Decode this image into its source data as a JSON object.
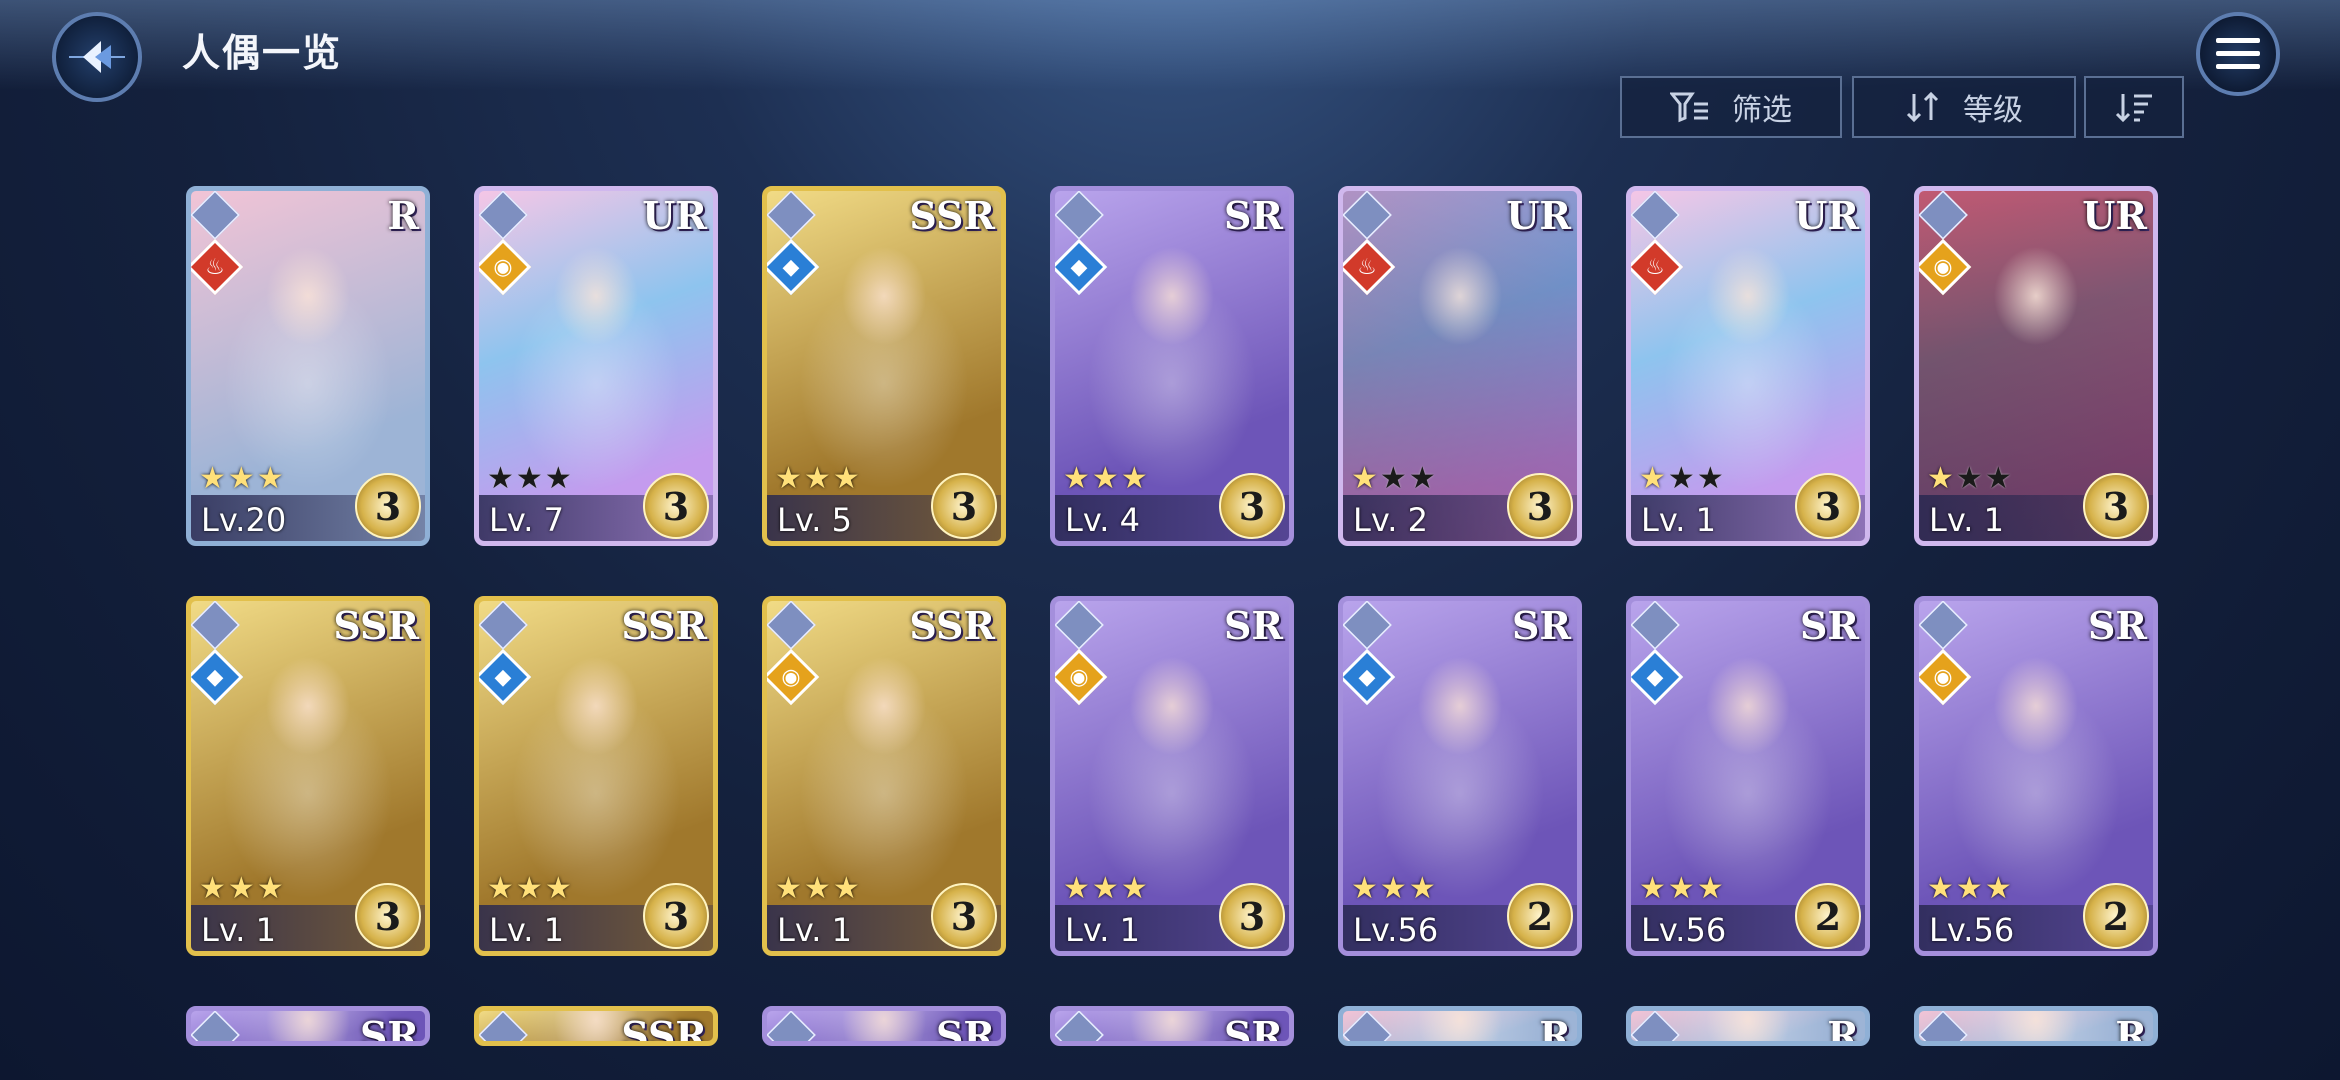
{
  "header": {
    "title": "人偶一览"
  },
  "toolbar": {
    "filter_label": "筛选",
    "sort_label": "等级"
  },
  "cards": [
    {
      "rarity": "R",
      "element": "fire",
      "stars": 3,
      "max_stars": 3,
      "level": "Lv.20",
      "count": "3"
    },
    {
      "rarity": "UR",
      "element": "light",
      "stars": 0,
      "max_stars": 3,
      "level": "Lv. 7",
      "count": "3"
    },
    {
      "rarity": "SSR",
      "element": "water",
      "stars": 3,
      "max_stars": 3,
      "level": "Lv. 5",
      "count": "3"
    },
    {
      "rarity": "SR",
      "element": "water",
      "stars": 3,
      "max_stars": 3,
      "level": "Lv. 4",
      "count": "3"
    },
    {
      "rarity": "UR",
      "element": "fire",
      "stars": 1,
      "max_stars": 3,
      "level": "Lv. 2",
      "count": "3"
    },
    {
      "rarity": "UR",
      "element": "fire",
      "stars": 1,
      "max_stars": 3,
      "level": "Lv. 1",
      "count": "3"
    },
    {
      "rarity": "UR",
      "element": "light",
      "stars": 1,
      "max_stars": 3,
      "level": "Lv. 1",
      "count": "3"
    },
    {
      "rarity": "SSR",
      "element": "water",
      "stars": 3,
      "max_stars": 3,
      "level": "Lv. 1",
      "count": "3"
    },
    {
      "rarity": "SSR",
      "element": "water",
      "stars": 3,
      "max_stars": 3,
      "level": "Lv. 1",
      "count": "3"
    },
    {
      "rarity": "SSR",
      "element": "light",
      "stars": 3,
      "max_stars": 3,
      "level": "Lv. 1",
      "count": "3"
    },
    {
      "rarity": "SR",
      "element": "light",
      "stars": 3,
      "max_stars": 3,
      "level": "Lv. 1",
      "count": "3"
    },
    {
      "rarity": "SR",
      "element": "water",
      "stars": 3,
      "max_stars": 3,
      "level": "Lv.56",
      "count": "2"
    },
    {
      "rarity": "SR",
      "element": "water",
      "stars": 3,
      "max_stars": 3,
      "level": "Lv.56",
      "count": "2"
    },
    {
      "rarity": "SR",
      "element": "light",
      "stars": 3,
      "max_stars": 3,
      "level": "Lv.56",
      "count": "2"
    },
    {
      "rarity": "SR",
      "element": "",
      "stars": 0,
      "max_stars": 0,
      "level": "",
      "count": ""
    },
    {
      "rarity": "SSR",
      "element": "",
      "stars": 0,
      "max_stars": 0,
      "level": "",
      "count": ""
    },
    {
      "rarity": "SR",
      "element": "",
      "stars": 0,
      "max_stars": 0,
      "level": "",
      "count": ""
    },
    {
      "rarity": "SR",
      "element": "",
      "stars": 0,
      "max_stars": 0,
      "level": "",
      "count": ""
    },
    {
      "rarity": "R",
      "element": "",
      "stars": 0,
      "max_stars": 0,
      "level": "",
      "count": ""
    },
    {
      "rarity": "R",
      "element": "",
      "stars": 0,
      "max_stars": 0,
      "level": "",
      "count": ""
    },
    {
      "rarity": "R",
      "element": "",
      "stars": 0,
      "max_stars": 0,
      "level": "",
      "count": ""
    }
  ],
  "colors": {
    "fire": "#d23a2a",
    "water": "#2a7fd6",
    "light": "#e5a21c"
  },
  "icons": {
    "back": "back-arrow-icon",
    "menu": "hamburger-menu-icon",
    "filter": "filter-icon",
    "sort": "sort-arrows-icon",
    "order": "sort-descending-icon"
  }
}
